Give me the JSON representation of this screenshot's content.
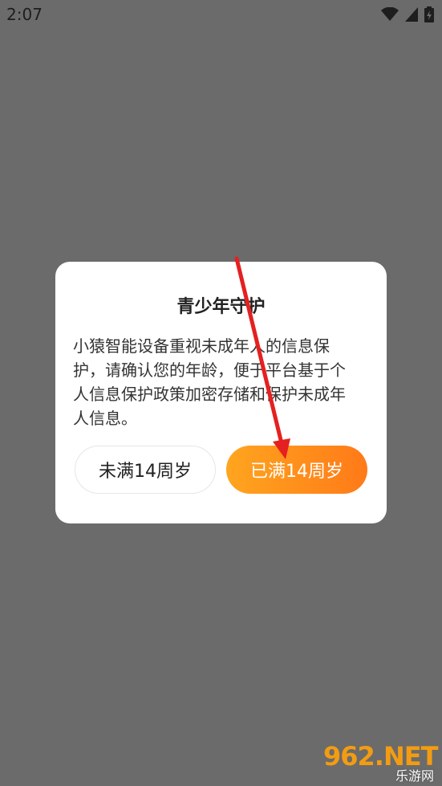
{
  "status_bar": {
    "time": "2:07"
  },
  "dialog": {
    "title": "青少年守护",
    "message": "小猿智能设备重视未成年人的信息保\n护，请确认您的年龄，便于平台基于个\n人信息保护政策加密存储和保护未成年\n人信息。",
    "buttons": {
      "under_14": "未满14周岁",
      "over_14": "已满14周岁"
    }
  },
  "watermark": {
    "main": "962.NET",
    "sub": "乐游网"
  },
  "colors": {
    "overlay": "#6b6b6b",
    "accent_start": "#ffa51f",
    "accent_end": "#ff7a18",
    "annotation_arrow": "#e52020"
  }
}
